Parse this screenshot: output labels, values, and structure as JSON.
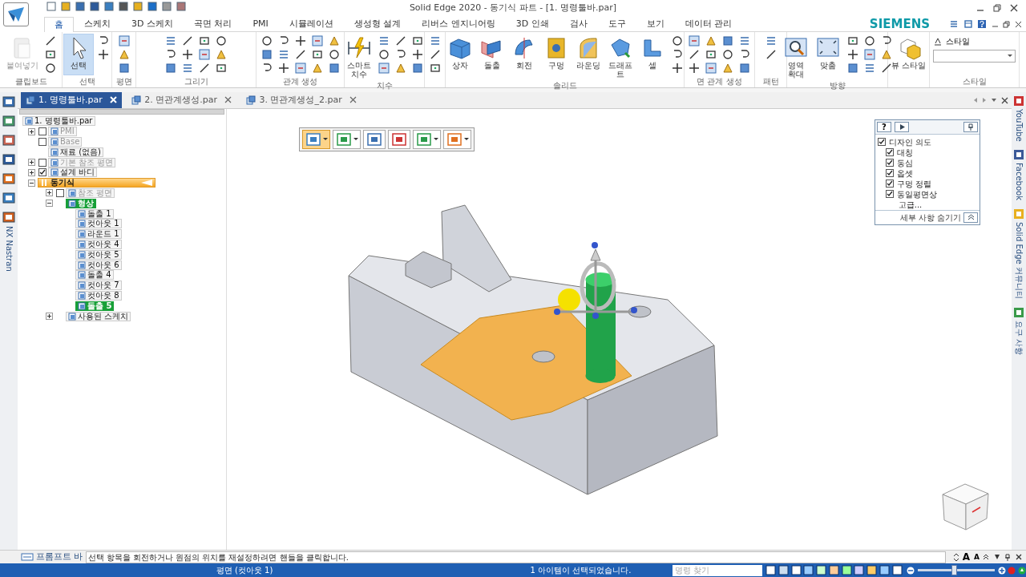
{
  "window": {
    "title": "Solid Edge 2020 - 동기식 파트 - [1. 명령툴바.par]",
    "brand": "SIEMENS"
  },
  "tabs": [
    {
      "label": "홈",
      "selected": true
    },
    {
      "label": "스케치",
      "selected": false
    },
    {
      "label": "3D 스케치",
      "selected": false
    },
    {
      "label": "곡면 처리",
      "selected": false
    },
    {
      "label": "PMI",
      "selected": false
    },
    {
      "label": "시뮬레이션",
      "selected": false
    },
    {
      "label": "생성형 설계",
      "selected": false
    },
    {
      "label": "리버스 엔지니어링",
      "selected": false
    },
    {
      "label": "3D 인쇄",
      "selected": false
    },
    {
      "label": "검사",
      "selected": false
    },
    {
      "label": "도구",
      "selected": false
    },
    {
      "label": "보기",
      "selected": false
    },
    {
      "label": "데이터 관리",
      "selected": false
    }
  ],
  "ribbon": {
    "groups": [
      {
        "kind": "clipboard",
        "label": "클립보드",
        "buttons": [
          {
            "label": "붙여넣기",
            "disabled": true,
            "active": false
          }
        ]
      },
      {
        "kind": "select",
        "label": "선택",
        "buttons": [
          {
            "label": "선택",
            "disabled": false,
            "active": true
          }
        ]
      },
      {
        "kind": "plane",
        "label": "평면"
      },
      {
        "kind": "draw",
        "label": "그리기"
      },
      {
        "kind": "relate",
        "label": "관계 생성"
      },
      {
        "kind": "dimension",
        "label": "치수",
        "buttons": [
          {
            "label": "스마트 치수",
            "disabled": false,
            "active": false
          }
        ]
      },
      {
        "kind": "text"
      },
      {
        "kind": "solid",
        "label": "솔리드",
        "buttons": [
          {
            "label": "상자",
            "disabled": false,
            "active": false
          },
          {
            "label": "돌출",
            "disabled": false,
            "active": false
          },
          {
            "label": "회전",
            "disabled": false,
            "active": false
          },
          {
            "label": "구멍",
            "disabled": false,
            "active": false
          },
          {
            "label": "라운딩",
            "disabled": false,
            "active": false
          },
          {
            "label": "드래프트",
            "disabled": false,
            "active": false
          },
          {
            "label": "셀",
            "disabled": false,
            "active": false
          }
        ]
      },
      {
        "kind": "face",
        "label": "면 관계 생성"
      },
      {
        "kind": "pattern",
        "label": "패턴"
      },
      {
        "kind": "orient",
        "label": "방향",
        "buttons": [
          {
            "label": "영역 확대",
            "disabled": false,
            "active": false
          },
          {
            "label": "맞춤",
            "disabled": false,
            "active": false
          }
        ]
      },
      {
        "kind": "viewstyle",
        "buttons": [
          {
            "label": "뷰 스타일",
            "disabled": false,
            "active": false
          }
        ]
      },
      {
        "kind": "style",
        "label": "스타일",
        "style_button": "스타일"
      }
    ]
  },
  "documents": [
    {
      "label": "1. 명령툴바.par",
      "selected": true
    },
    {
      "label": "2. 면관계생성.par",
      "selected": false
    },
    {
      "label": "3. 면관계생성_2.par",
      "selected": false
    }
  ],
  "left_strip": {
    "label": "NX Nastran"
  },
  "right_strip": [
    {
      "label": "YouTube"
    },
    {
      "label": "Facebook"
    },
    {
      "label": "Solid Edge 커뮤니티"
    },
    {
      "label": "요구 사항"
    }
  ],
  "tree": [
    {
      "label": "1. 명령툴바.par",
      "children": [
        {
          "label": "PMI",
          "expanded": false,
          "checked": false,
          "dimmed": true
        },
        {
          "label": "Base",
          "checked": false,
          "dimmed": true
        },
        {
          "label": "재료 (없음)",
          "dimmed": false
        },
        {
          "label": "기본 참조 평면",
          "expanded": false,
          "checked": false,
          "dimmed": true
        },
        {
          "label": "설계 바디",
          "expanded": false,
          "checked": true,
          "dimmed": false
        },
        {
          "label": "동기식",
          "kind": "section",
          "expanded": true,
          "children": [
            {
              "label": "참조 평면",
              "expanded": false,
              "checked": false,
              "dimmed": true
            },
            {
              "label": "형상",
              "expanded": true,
              "selected": true,
              "children": [
                {
                  "label": "돌출 1",
                  "selected": false
                },
                {
                  "label": "컷아웃 1",
                  "selected": false
                },
                {
                  "label": "라운드 1",
                  "selected": false
                },
                {
                  "label": "컷아웃 4",
                  "selected": false
                },
                {
                  "label": "컷아웃 5",
                  "selected": false
                },
                {
                  "label": "컷아웃 6",
                  "selected": false
                },
                {
                  "label": "돌출 4",
                  "selected": false
                },
                {
                  "label": "컷아웃 7",
                  "selected": false
                },
                {
                  "label": "컷아웃 8",
                  "selected": false
                },
                {
                  "label": "돌출 5",
                  "selected": true
                }
              ]
            },
            {
              "label": "사용된 스케치",
              "expanded": false,
              "selected": false
            }
          ]
        }
      ]
    }
  ],
  "command_bar": [
    {
      "selected": true,
      "has_menu": true
    },
    {
      "selected": false,
      "has_menu": true
    },
    {
      "selected": false,
      "has_menu": false
    },
    {
      "selected": false,
      "has_menu": false
    },
    {
      "selected": false,
      "has_menu": true
    },
    {
      "selected": false,
      "has_menu": true
    }
  ],
  "design_intent": {
    "help": "?",
    "title": {
      "label": "디자인 의도",
      "checked": true
    },
    "items": [
      {
        "label": "대칭",
        "checked": true
      },
      {
        "label": "동심",
        "checked": true
      },
      {
        "label": "옵셋",
        "checked": true
      },
      {
        "label": "구멍 정렬",
        "checked": true
      },
      {
        "label": "동일평면상",
        "checked": true
      }
    ],
    "advanced": "고급...",
    "footer": "세부 사항 숨기기"
  },
  "prompt_bar": {
    "label": "프롬프트 바",
    "message": "선택 항목을 회전하거나 원점의 위치를 재설정하려면 핸들을 클릭합니다.",
    "font_buttons": [
      "A",
      "A"
    ]
  },
  "status_bar": {
    "plane": "평면 (컷아웃 1)",
    "selection": "1 아이템이 선택되었습니다.",
    "search": {
      "placeholder": "명령 찾기"
    },
    "zoom": {
      "level": 0.47
    }
  }
}
